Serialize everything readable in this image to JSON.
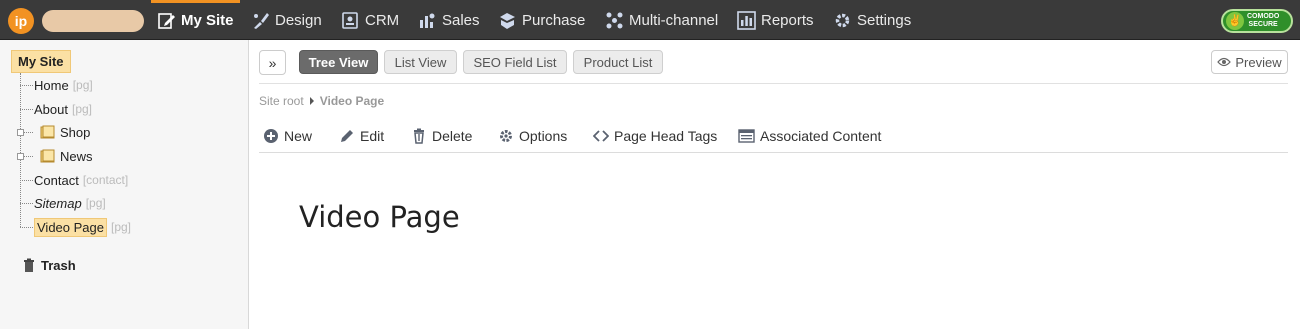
{
  "nav": {
    "logo": "ip",
    "items": [
      {
        "label": "My Site",
        "icon": "edit-icon"
      },
      {
        "label": "Design",
        "icon": "brush-icon"
      },
      {
        "label": "CRM",
        "icon": "contact-card-icon"
      },
      {
        "label": "Sales",
        "icon": "sales-icon"
      },
      {
        "label": "Purchase",
        "icon": "purchase-icon"
      },
      {
        "label": "Multi-channel",
        "icon": "multichannel-icon"
      },
      {
        "label": "Reports",
        "icon": "bar-chart-icon"
      },
      {
        "label": "Settings",
        "icon": "gear-icon"
      }
    ],
    "secure_badge": {
      "line1": "COMODO",
      "line2": "SECURE"
    }
  },
  "tree": {
    "root": "My Site",
    "items": [
      {
        "label": "Home",
        "tag": "[pg]"
      },
      {
        "label": "About",
        "tag": "[pg]"
      },
      {
        "label": "Shop",
        "tag": ""
      },
      {
        "label": "News",
        "tag": ""
      },
      {
        "label": "Contact",
        "tag": "[contact]"
      },
      {
        "label": "Sitemap",
        "tag": "[pg]"
      },
      {
        "label": "Video Page",
        "tag": "[pg]"
      }
    ],
    "trash": "Trash"
  },
  "toolbar": {
    "tabs": [
      "Tree View",
      "List View",
      "SEO Field List",
      "Product List"
    ],
    "active_tab": "Tree View",
    "preview": "Preview"
  },
  "breadcrumb": {
    "root": "Site root",
    "current": "Video Page"
  },
  "actions": [
    "New",
    "Edit",
    "Delete",
    "Options",
    "Page Head Tags",
    "Associated Content"
  ],
  "page": {
    "title": "Video Page"
  },
  "colors": {
    "accent": "#f29222",
    "nav_bg": "#3a3a3a",
    "selection": "#fbe0a4"
  }
}
